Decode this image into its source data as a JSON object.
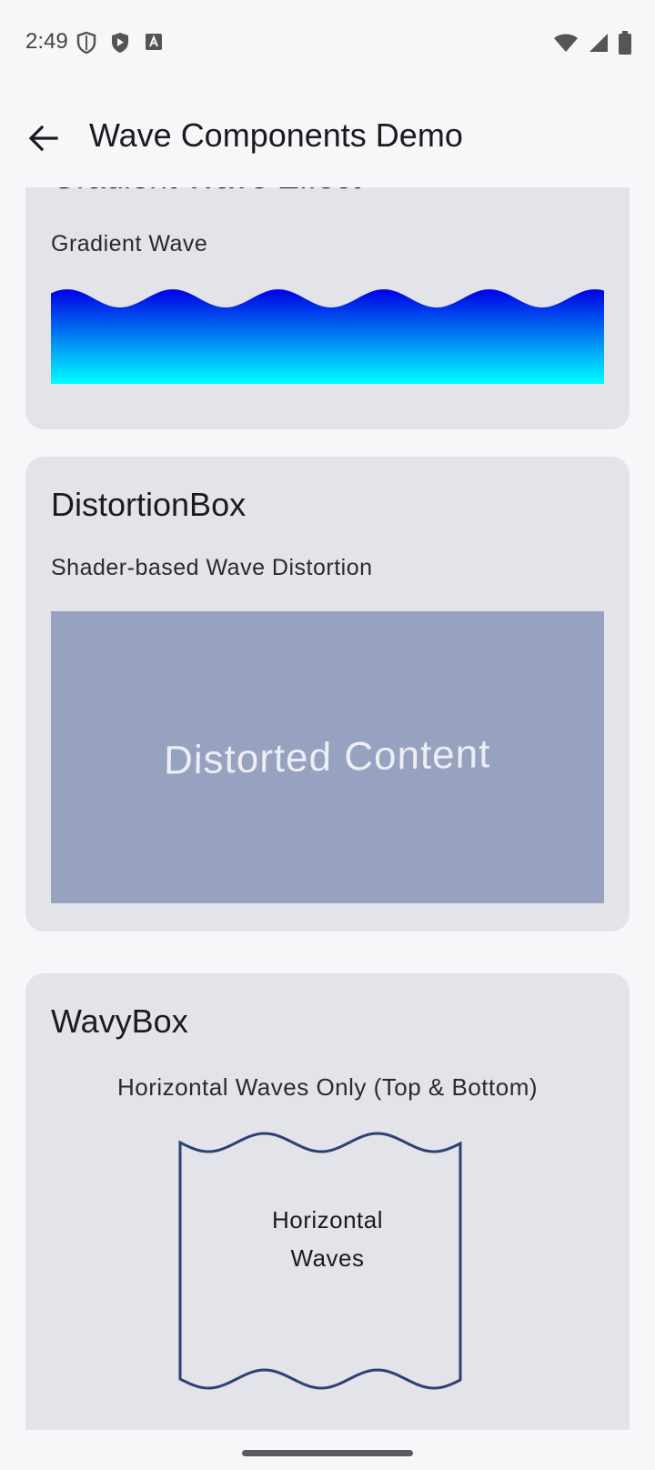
{
  "status_bar": {
    "time": "2:49",
    "icons_left": [
      "shield-icon",
      "play-shield-icon",
      "font-icon"
    ],
    "icons_right": [
      "wifi-icon",
      "signal-icon",
      "battery-icon"
    ]
  },
  "app_bar": {
    "title": "Wave Components Demo",
    "back_icon": "arrow-back-icon"
  },
  "cards": {
    "gradient": {
      "title": "Gradient Wave Effect",
      "subtitle": "Gradient Wave",
      "gradient_top": "#0000e6",
      "gradient_bottom": "#00ffff"
    },
    "distortion": {
      "title": "DistortionBox",
      "subtitle": "Shader-based Wave Distortion",
      "content_text": "Distorted Content",
      "box_color": "#97a1c0"
    },
    "wavy": {
      "title": "WavyBox",
      "subtitle": "Horizontal Waves Only (Top & Bottom)",
      "box_line1": "Horizontal",
      "box_line2": "Waves",
      "border_color": "#2e4173"
    }
  },
  "colors": {
    "background": "#f7f7fa",
    "card": "#e3e4ea"
  }
}
